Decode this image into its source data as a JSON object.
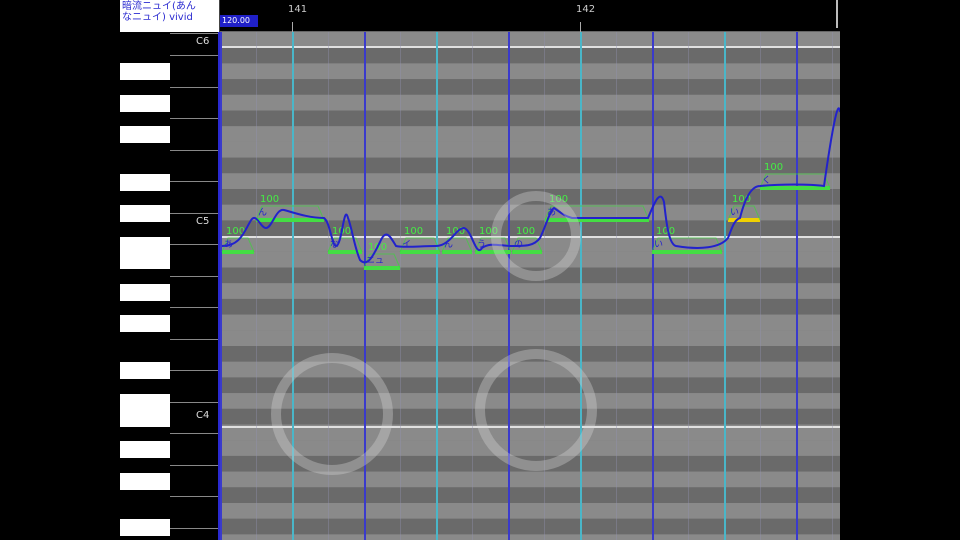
{
  "track": {
    "name": "暗流ニュイ(あん\nなニュイ) vivid",
    "tempo": "120.00"
  },
  "ruler": {
    "bars": [
      "141",
      "142"
    ]
  },
  "keyboard": {
    "octave_labels": [
      "C6",
      "C5",
      "C4"
    ]
  },
  "notes": [
    {
      "lyric": "あ",
      "velocity": "100"
    },
    {
      "lyric": "ん",
      "velocity": "100"
    },
    {
      "lyric": "な",
      "velocity": "100"
    },
    {
      "lyric": "ニュ",
      "velocity": "100"
    },
    {
      "lyric": "イ",
      "velocity": "100"
    },
    {
      "lyric": "ん",
      "velocity": "100"
    },
    {
      "lyric": "う",
      "velocity": "100"
    },
    {
      "lyric": "の",
      "velocity": "100"
    },
    {
      "lyric": "あ",
      "velocity": "100"
    },
    {
      "lyric": "い",
      "velocity": "100"
    },
    {
      "lyric": "く",
      "velocity": "100"
    },
    {
      "lyric": "い",
      "velocity": "100"
    }
  ],
  "colors": {
    "note": "#44dd44",
    "selected_note": "#f0d000",
    "pitch_curve": "#2222cc",
    "beat_line": "#4ab6c8",
    "sub_beat_line": "#3a3acc"
  }
}
